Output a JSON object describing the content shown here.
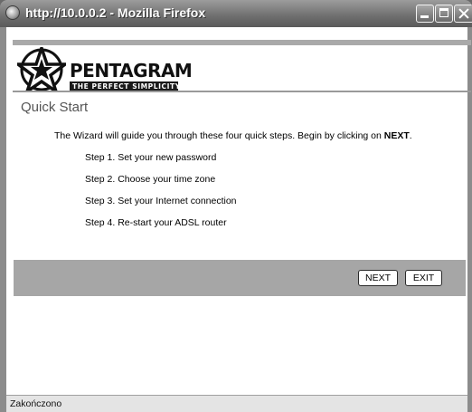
{
  "window": {
    "title": "http://10.0.0.2 - Mozilla Firefox",
    "icon": "firefox-icon"
  },
  "logo": {
    "name": "PENTAGRAM",
    "tagline": "THE PERFECT SIMPLICITY"
  },
  "page": {
    "title": "Quick Start",
    "intro_text": "The Wizard will guide you through these four quick steps. Begin by clicking on ",
    "intro_emphasis": "NEXT",
    "intro_end": ".",
    "steps": [
      "Step 1. Set your new password",
      "Step 2. Choose your time zone",
      "Step 3. Set your Internet connection",
      "Step 4. Re-start your ADSL router"
    ]
  },
  "buttons": {
    "next": "NEXT",
    "exit": "EXIT"
  },
  "status": {
    "text": "Zakończono"
  }
}
